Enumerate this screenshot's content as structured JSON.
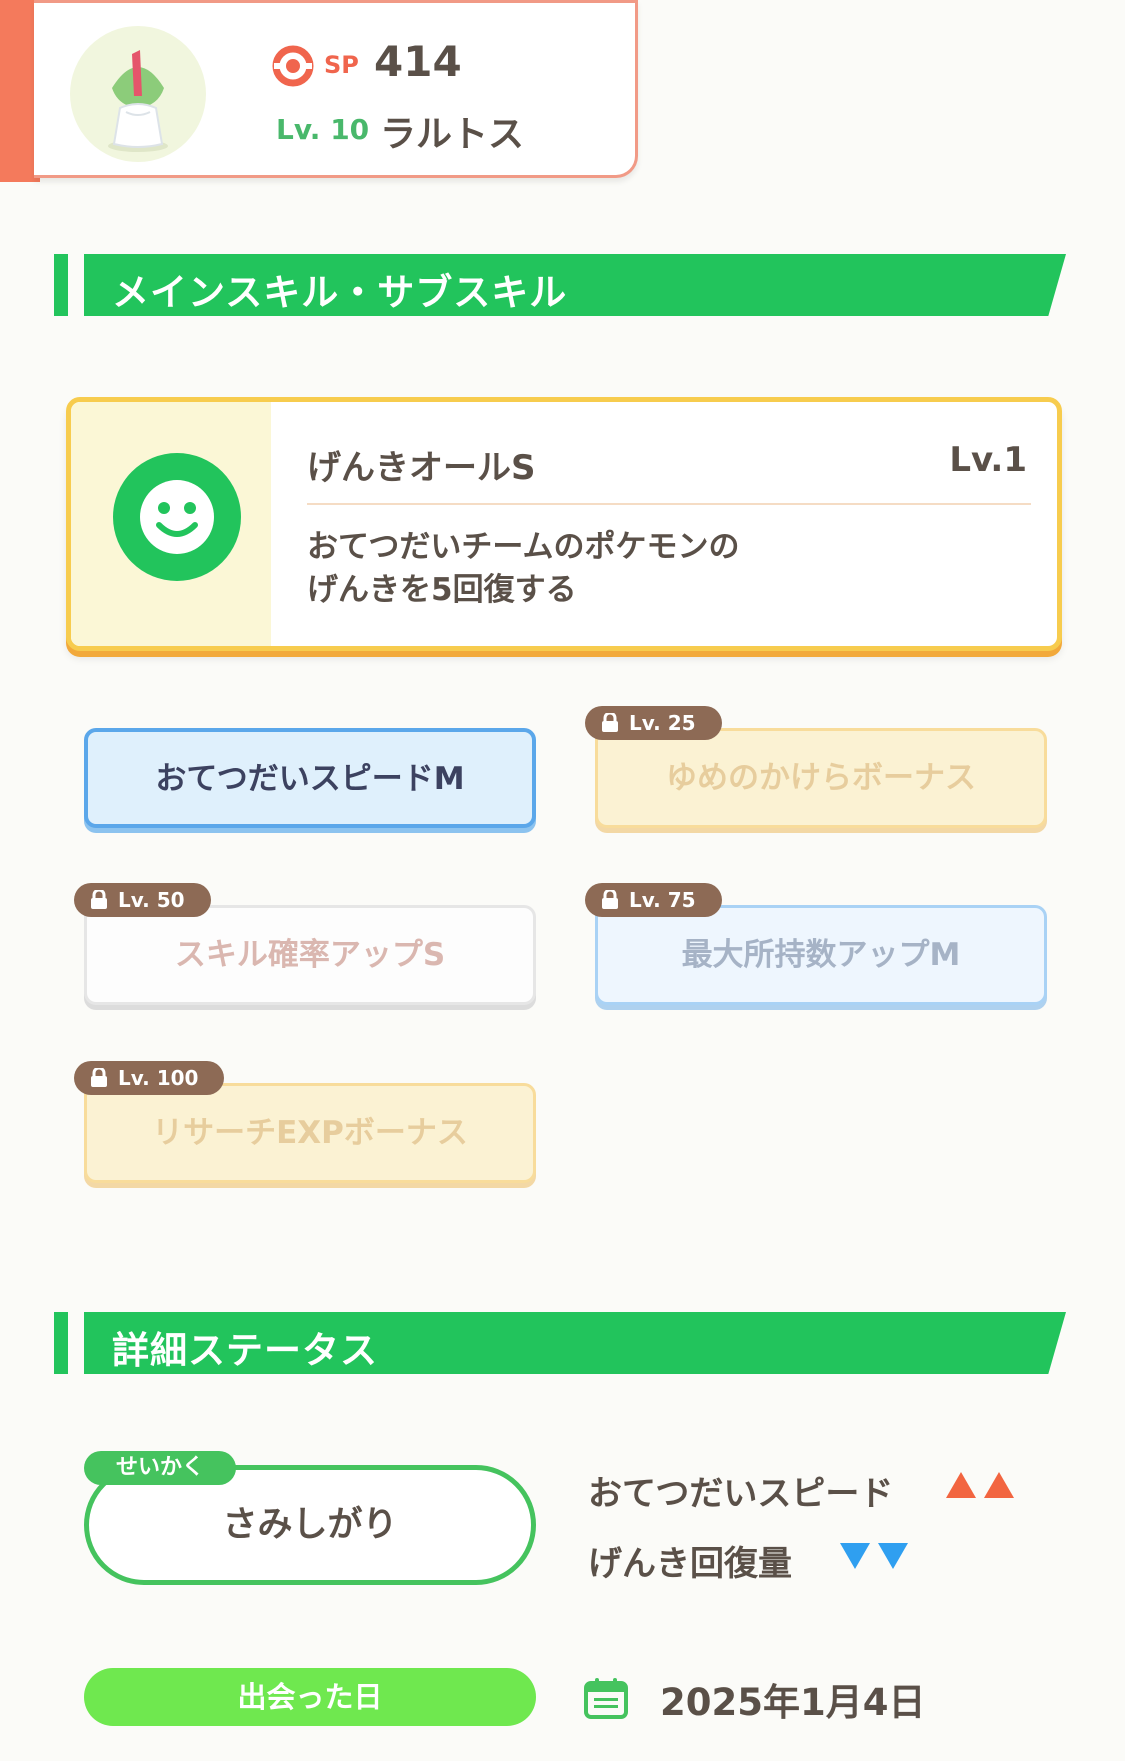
{
  "header": {
    "sp_label": "SP",
    "sp_value": "414",
    "level_label": "Lv. 10",
    "pokemon_name": "ラルトス",
    "accent_color": "#f47a5c"
  },
  "skills_section": {
    "title": "メインスキル・サブスキル",
    "main_skill": {
      "name": "げんきオールS",
      "level": "Lv.1",
      "description_line1": "おてつだいチームのポケモンの",
      "description_line2": "げんきを5回復する",
      "icon": "smiley-face-icon"
    },
    "sub_skills": [
      {
        "name": "おてつだいスピードM",
        "unlock": "",
        "locked": false
      },
      {
        "name": "ゆめのかけらボーナス",
        "unlock": "Lv. 25",
        "locked": true
      },
      {
        "name": "スキル確率アップS",
        "unlock": "Lv. 50",
        "locked": true
      },
      {
        "name": "最大所持数アップM",
        "unlock": "Lv. 75",
        "locked": true
      },
      {
        "name": "リサーチEXPボーナス",
        "unlock": "Lv. 100",
        "locked": true
      }
    ]
  },
  "status_section": {
    "title": "詳細ステータス",
    "nature_tag": "せいかく",
    "nature_name": "さみしがり",
    "up_stat": "おてつだいスピード",
    "down_stat": "げんき回復量",
    "up_color": "#f26540",
    "down_color": "#2f9ff0",
    "met_label": "出会った日",
    "met_date": "2025年1月4日"
  }
}
